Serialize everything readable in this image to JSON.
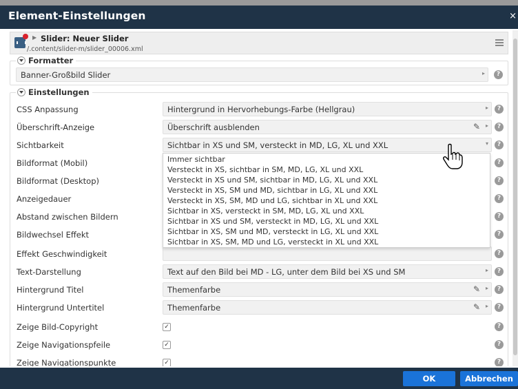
{
  "dialog": {
    "title": "Element-Einstellungen",
    "close_glyph": "×"
  },
  "resource": {
    "title": "Slider: Neuer Slider",
    "path": "/.content/slider-m/slider_00006.xml",
    "icon": "slider-resource-icon"
  },
  "formatter": {
    "legend": "Formatter",
    "value": "Banner-Großbild Slider"
  },
  "settings": {
    "legend": "Einstellungen",
    "rows": [
      {
        "label": "CSS Anpassung",
        "value": "Hintergrund in Hervorhebungs-Farbe (Hellgrau)"
      },
      {
        "label": "Überschrift-Anzeige",
        "value": "Überschrift ausblenden"
      },
      {
        "label": "Sichtbarkeit",
        "value": "Sichtbar in XS und SM, versteckt in MD, LG, XL und XXL"
      },
      {
        "label": "Bildformat (Mobil)",
        "value": ""
      },
      {
        "label": "Bildformat (Desktop)",
        "value": ""
      },
      {
        "label": "Anzeigedauer",
        "value": ""
      },
      {
        "label": "Abstand zwischen Bildern",
        "value": ""
      },
      {
        "label": "Bildwechsel Effekt",
        "value": ""
      },
      {
        "label": "Effekt Geschwindigkeit",
        "value": ""
      },
      {
        "label": "Text-Darstellung",
        "value": "Text auf den Bild bei MD - LG, unter dem Bild bei XS und SM"
      },
      {
        "label": "Hintergrund Titel",
        "value": "Themenfarbe"
      },
      {
        "label": "Hintergrund Untertitel",
        "value": "Themenfarbe"
      },
      {
        "label": "Zeige Bild-Copyright",
        "checked": true
      },
      {
        "label": "Zeige Navigationspfeile",
        "checked": true
      },
      {
        "label": "Zeige Navigationspunkte",
        "checked": true
      }
    ]
  },
  "visibility_options": [
    "Immer sichtbar",
    "Versteckt in XS, sichtbar in SM, MD, LG, XL und XXL",
    "Versteckt in XS und SM, sichtbar in MD, LG, XL und XXL",
    "Versteckt in XS, SM und MD, sichtbar in LG, XL und XXL",
    "Versteckt in XS, SM, MD und LG, sichtbar in XL und XXL",
    "Sichtbar in XS, versteckt in SM, MD, LG, XL und XXL",
    "Sichtbar in XS und SM, versteckt in MD, LG, XL und XXL",
    "Sichtbar in XS, SM und MD, versteckt in LG, XL und XXL",
    "Sichtbar in XS, SM, MD und LG, versteckt in XL und XXL"
  ],
  "help_glyph": "?",
  "check_glyph": "✓",
  "pencil_glyph": "✎",
  "arrow_right_glyph": "▸",
  "arrow_down_glyph": "▾",
  "footer": {
    "ok_label": "OK",
    "cancel_label": "Abbrechen"
  },
  "colors": {
    "titlebar": "#1f3347",
    "button": "#1a73d9",
    "accent_dot": "#d9232d"
  }
}
